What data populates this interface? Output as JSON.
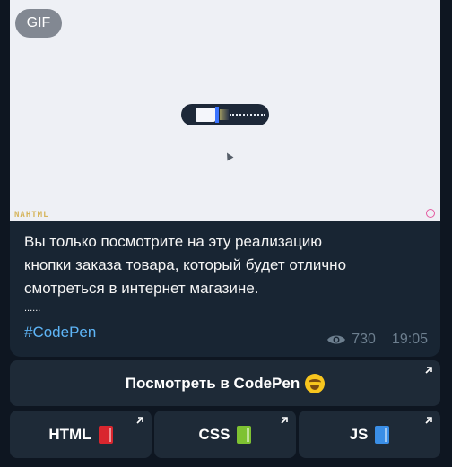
{
  "media": {
    "badge": "GIF",
    "watermark": "NAHTML"
  },
  "message": {
    "lines": [
      "Вы только посмотрите на эту реализацию",
      "кнопки заказа товара, который будет отлично",
      "смотреться в интернет магазине.",
      "......"
    ],
    "hashtag": "#CodePen",
    "views": "730",
    "time": "19:05"
  },
  "buttons": {
    "codepen": {
      "label": "Посмотреть в CodePen",
      "emoji": "star-struck-face-icon"
    },
    "html": {
      "label": "HTML",
      "icon": "red-book-icon"
    },
    "css": {
      "label": "CSS",
      "icon": "green-book-icon"
    },
    "js": {
      "label": "JS",
      "icon": "blue-book-icon"
    }
  },
  "colors": {
    "background": "#0e1621",
    "bubble": "#182533",
    "button": "#1e2a37",
    "link": "#5eb5f7",
    "meta": "#6d7f8f"
  }
}
